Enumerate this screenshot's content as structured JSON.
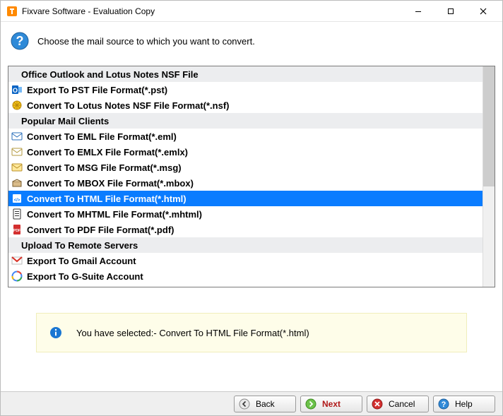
{
  "titlebar": {
    "title": "Fixvare Software - Evaluation Copy"
  },
  "instruction": "Choose the mail source to which you want to convert.",
  "list": {
    "rows": [
      {
        "kind": "header",
        "label": "Office Outlook and Lotus Notes NSF File",
        "selected": false,
        "icon": ""
      },
      {
        "kind": "item",
        "label": "Export To PST File Format(*.pst)",
        "selected": false,
        "icon": "outlook"
      },
      {
        "kind": "item",
        "label": "Convert To Lotus Notes NSF File Format(*.nsf)",
        "selected": false,
        "icon": "lotus"
      },
      {
        "kind": "header",
        "label": "Popular Mail Clients",
        "selected": false,
        "icon": ""
      },
      {
        "kind": "item",
        "label": "Convert To EML File Format(*.eml)",
        "selected": false,
        "icon": "eml"
      },
      {
        "kind": "item",
        "label": "Convert To EMLX File Format(*.emlx)",
        "selected": false,
        "icon": "emlx"
      },
      {
        "kind": "item",
        "label": "Convert To MSG File Format(*.msg)",
        "selected": false,
        "icon": "msg"
      },
      {
        "kind": "item",
        "label": "Convert To MBOX File Format(*.mbox)",
        "selected": false,
        "icon": "mbox"
      },
      {
        "kind": "item",
        "label": "Convert To HTML File Format(*.html)",
        "selected": true,
        "icon": "html"
      },
      {
        "kind": "item",
        "label": "Convert To MHTML File Format(*.mhtml)",
        "selected": false,
        "icon": "mhtml"
      },
      {
        "kind": "item",
        "label": "Convert To PDF File Format(*.pdf)",
        "selected": false,
        "icon": "pdf"
      },
      {
        "kind": "header",
        "label": "Upload To Remote Servers",
        "selected": false,
        "icon": ""
      },
      {
        "kind": "item",
        "label": "Export To Gmail Account",
        "selected": false,
        "icon": "gmail"
      },
      {
        "kind": "item",
        "label": "Export To G-Suite Account",
        "selected": false,
        "icon": "gsuite"
      }
    ]
  },
  "hint": {
    "text": "You have selected:- Convert To HTML File Format(*.html)"
  },
  "footer": {
    "back": "Back",
    "next": "Next",
    "cancel": "Cancel",
    "help": "Help"
  }
}
